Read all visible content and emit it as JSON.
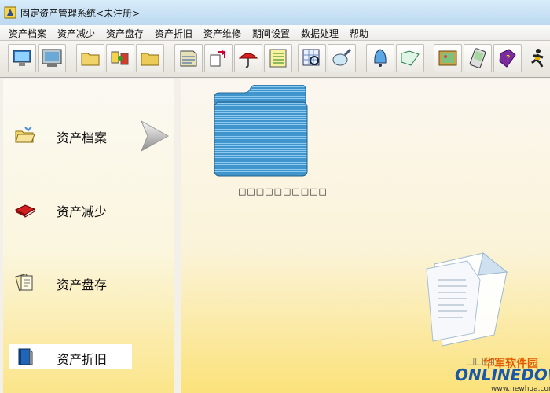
{
  "window": {
    "title": "固定资产管理系统<未注册>"
  },
  "menu": {
    "items": [
      "资产档案",
      "资产减少",
      "资产盘存",
      "资产折旧",
      "资产维修",
      "期间设置",
      "数据处理",
      "帮助"
    ]
  },
  "toolbar": {
    "buttons": [
      "monitor-icon",
      "screen-icon",
      "open-folder-icon",
      "swap-icon",
      "folder-icon",
      "archive-icon",
      "transfer-icon",
      "umbrella-icon",
      "notebook-icon",
      "table-search-icon",
      "magnifier-icon",
      "bell-icon",
      "book-icon",
      "picture-icon",
      "handheld-icon",
      "help-book-icon",
      "runner-icon"
    ]
  },
  "sidebar": {
    "items": [
      {
        "label": "资产档案",
        "icon": "open-folder-icon"
      },
      {
        "label": "资产减少",
        "icon": "red-book-icon"
      },
      {
        "label": "资产盘存",
        "icon": "document-stack-icon"
      },
      {
        "label": "资产折旧",
        "icon": "blue-book-icon"
      }
    ],
    "active_index": 3
  },
  "main": {
    "folder_label": "□□□□□□□□□□"
  },
  "watermark": {
    "small": "□□□□",
    "brand": "华军软件园",
    "logo": "ONLINEDOWN",
    "url": "www.newhua.com"
  },
  "colors": {
    "folder": "#3f95cc",
    "left_bg_bottom": "#fbe58a",
    "watermark_brand": "#e35a00",
    "watermark_logo": "#1858a8"
  }
}
